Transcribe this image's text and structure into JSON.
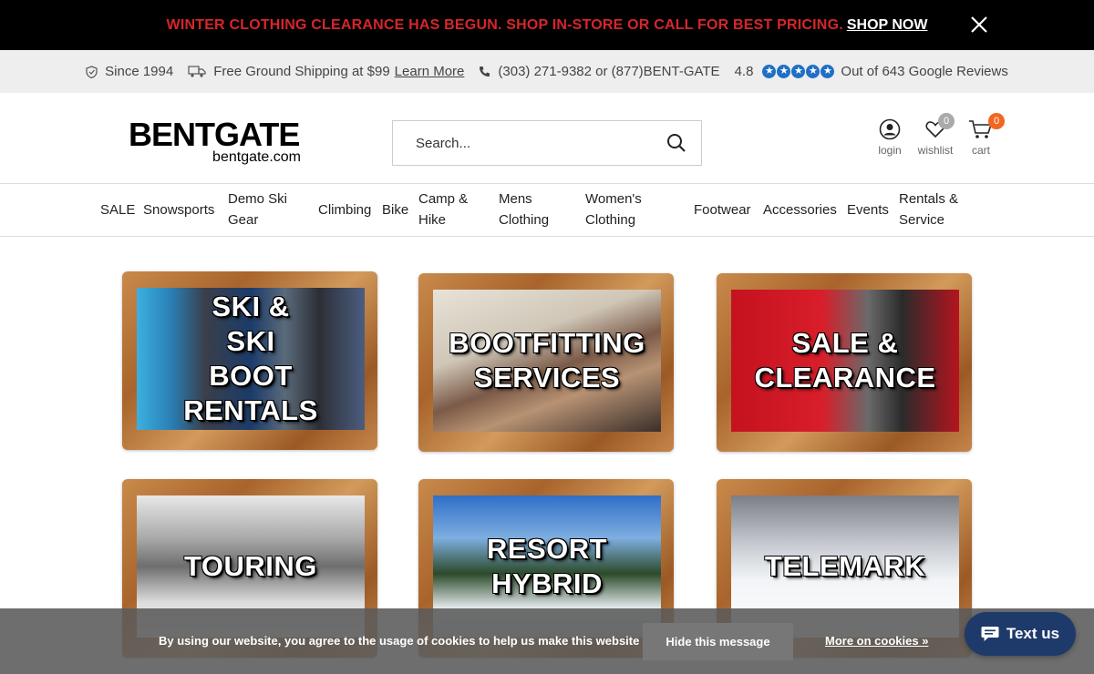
{
  "promo": {
    "text": "WINTER CLOTHING CLEARANCE HAS BEGUN. SHOP IN-STORE OR CALL FOR BEST PRICING.",
    "link": "SHOP NOW"
  },
  "infobar": {
    "since": "Since 1994",
    "shipping": "Free Ground Shipping at $99",
    "learn_more": "Learn More",
    "phone": "(303) 271-9382 or (877)BENT-GATE",
    "rating": "4.8",
    "reviews": "Out of 643 Google Reviews"
  },
  "header": {
    "logo_main": "BENTGATE",
    "logo_sub": "bentgate.com",
    "search_placeholder": "Search...",
    "login_label": "login",
    "wishlist_label": "wishlist",
    "wishlist_count": "0",
    "cart_label": "cart",
    "cart_count": "0"
  },
  "nav": {
    "items": [
      "SALE",
      "Snowsports",
      "Demo Ski\nGear",
      "Climbing",
      "Bike",
      "Camp &\nHike",
      "Mens\nClothing",
      "Women's\nClothing",
      "Footwear",
      "Accessories",
      "Events",
      "Rentals &\nService"
    ]
  },
  "tiles": [
    {
      "label": "SKI &\nSKI\nBOOT\nRENTALS"
    },
    {
      "label": "BOOTFITTING\nSERVICES"
    },
    {
      "label": "SALE &\nCLEARANCE"
    },
    {
      "label": "TOURING"
    },
    {
      "label": "RESORT\nHYBRID"
    },
    {
      "label": "TELEMARK"
    }
  ],
  "cookie": {
    "text": "By using our website, you agree to the usage of cookies to help us make this website better.",
    "button": "Hide this message",
    "link": "More on cookies »"
  },
  "textus": {
    "label": "Text us"
  },
  "colors": {
    "promo_red": "#d6262b",
    "cart_badge": "#f26522",
    "wishlist_badge": "#aaaaaa",
    "star_blue": "#1f6fc5",
    "textus_navy": "#1e3a6b"
  }
}
